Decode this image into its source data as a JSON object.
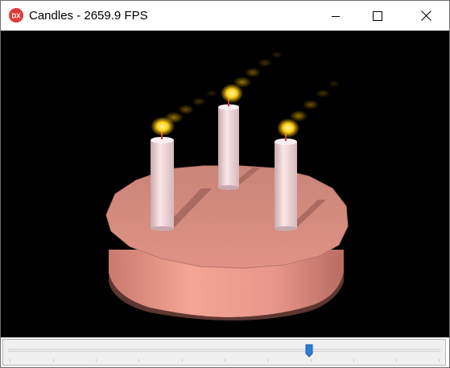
{
  "window": {
    "title": "Candles - 2659.9 FPS",
    "icon_text": "DX",
    "icon_name": "directx-app-icon",
    "icon_color": "#e03a3a",
    "controls": {
      "minimize_icon": "minimize-icon",
      "maximize_icon": "maximize-icon",
      "close_icon": "close-icon"
    }
  },
  "scene": {
    "background": "#000000",
    "cake_top_color": "#d88a7e",
    "cake_side_color": "#e8998a",
    "candle_color": "#f2d8dc",
    "flame_color": "#ffd21a",
    "candle_count": 3
  },
  "trackbar": {
    "position_fraction": 0.7,
    "thumb_color": "#2e7bd6"
  }
}
